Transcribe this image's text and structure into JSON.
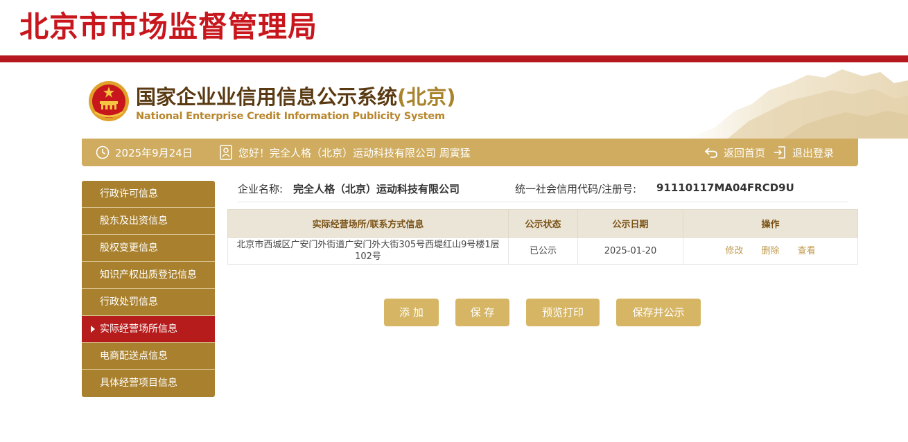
{
  "header": {
    "bureau_title": "北京市市场监督管理局",
    "system_title": "国家企业业信用信息公示系统",
    "system_title_region": "(北京)",
    "system_subtitle": "National Enterprise Credit Information Publicity System"
  },
  "infobar": {
    "date": "2025年9月24日",
    "greeting": "您好！完全人格（北京）运动科技有限公司 周寅猛",
    "home_label": "返回首页",
    "logout_label": "退出登录"
  },
  "sidebar": {
    "items": [
      {
        "label": "行政许可信息",
        "active": false
      },
      {
        "label": "股东及出资信息",
        "active": false
      },
      {
        "label": "股权变更信息",
        "active": false
      },
      {
        "label": "知识产权出质登记信息",
        "active": false
      },
      {
        "label": "行政处罚信息",
        "active": false
      },
      {
        "label": "实际经营场所信息",
        "active": true
      },
      {
        "label": "电商配送点信息",
        "active": false
      },
      {
        "label": "具体经营项目信息",
        "active": false
      }
    ]
  },
  "company": {
    "name_label": "企业名称:",
    "name": "完全人格（北京）运动科技有限公司",
    "code_label": "统一社会信用代码/注册号:",
    "code": "91110117MA04FRCD9U"
  },
  "table": {
    "headers": [
      "实际经营场所/联系方式信息",
      "公示状态",
      "公示日期",
      "操作"
    ],
    "rows": [
      {
        "address": "北京市西城区广安门外街道广安门外大街305号西堤红山9号楼1层102号",
        "status": "已公示",
        "date": "2025-01-20",
        "actions": [
          "修改",
          "删除",
          "查看"
        ]
      }
    ]
  },
  "buttons": {
    "add": "添 加",
    "save": "保 存",
    "preview": "预览打印",
    "save_publish": "保存并公示"
  },
  "colors": {
    "brand_red": "#c8161d",
    "gold": "#cfac5f",
    "sidebar_gold": "#a9802d",
    "active_red": "#b71c1c"
  }
}
